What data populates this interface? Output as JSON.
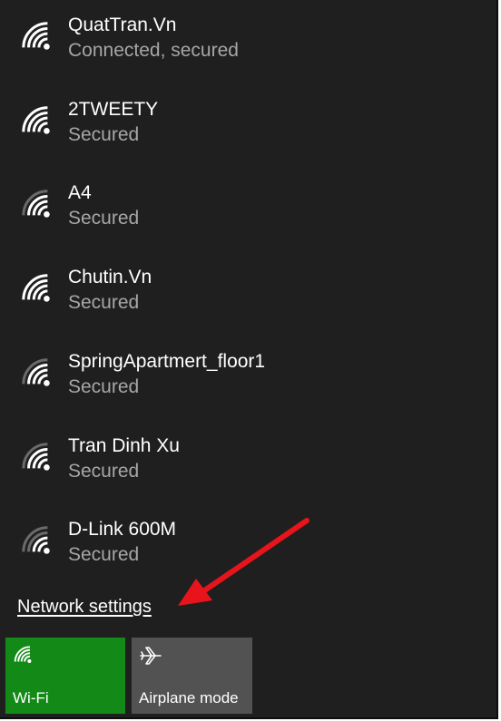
{
  "networks": [
    {
      "name": "QuatTran.Vn",
      "status": "Connected, secured"
    },
    {
      "name": "2TWEETY",
      "status": "Secured"
    },
    {
      "name": "A4",
      "status": "Secured"
    },
    {
      "name": "Chutin.Vn",
      "status": "Secured"
    },
    {
      "name": "SpringApartmert_floor1",
      "status": "Secured"
    },
    {
      "name": "Tran Dinh Xu",
      "status": "Secured"
    },
    {
      "name": "D-Link 600M",
      "status": "Secured"
    }
  ],
  "network_settings_label": "Network settings",
  "tiles": {
    "wifi": {
      "label": "Wi-Fi",
      "icon": "wifi-icon",
      "color": "#138a18"
    },
    "airplane": {
      "label": "Airplane mode",
      "icon": "airplane-icon",
      "color": "#525252"
    }
  },
  "annotation": {
    "icon": "red-arrow",
    "color": "#e8141c"
  },
  "colors": {
    "panel_background": "#1f1f1f",
    "primary_text": "#ffffff",
    "secondary_text": "#a6a6a6"
  }
}
